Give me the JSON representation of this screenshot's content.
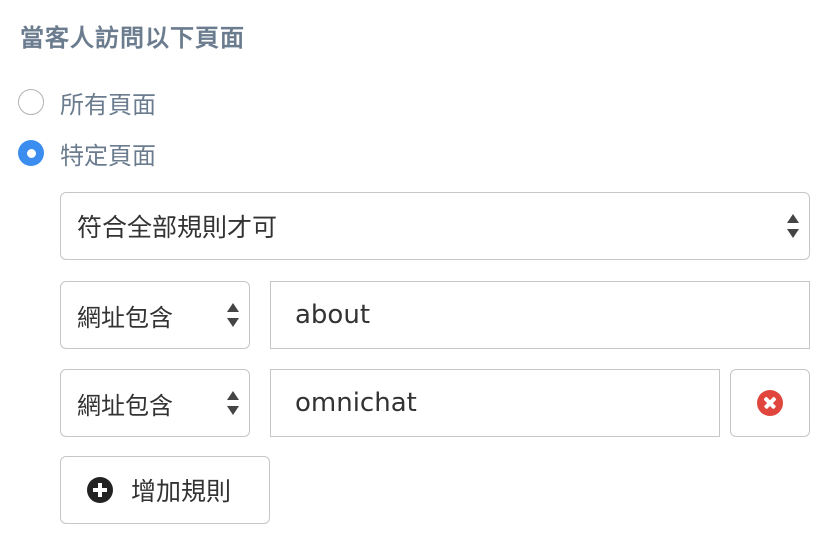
{
  "section": {
    "title": "當客人訪問以下頁面"
  },
  "scope_options": [
    {
      "label": "所有頁面",
      "checked": false
    },
    {
      "label": "特定頁面",
      "checked": true
    }
  ],
  "match_mode": {
    "selected": "符合全部規則才可"
  },
  "rules": [
    {
      "condition": "網址包含",
      "value": "about",
      "removable": false
    },
    {
      "condition": "網址包含",
      "value": "omnichat",
      "removable": true
    }
  ],
  "actions": {
    "add_rule_label": "增加規則"
  },
  "icons": {
    "remove": "remove-circle-icon",
    "add": "plus-circle-icon",
    "select_caret": "updown-caret-icon"
  },
  "colors": {
    "accent": "#3b8ef0",
    "danger": "#e0463e",
    "label": "#6b7c8f"
  }
}
